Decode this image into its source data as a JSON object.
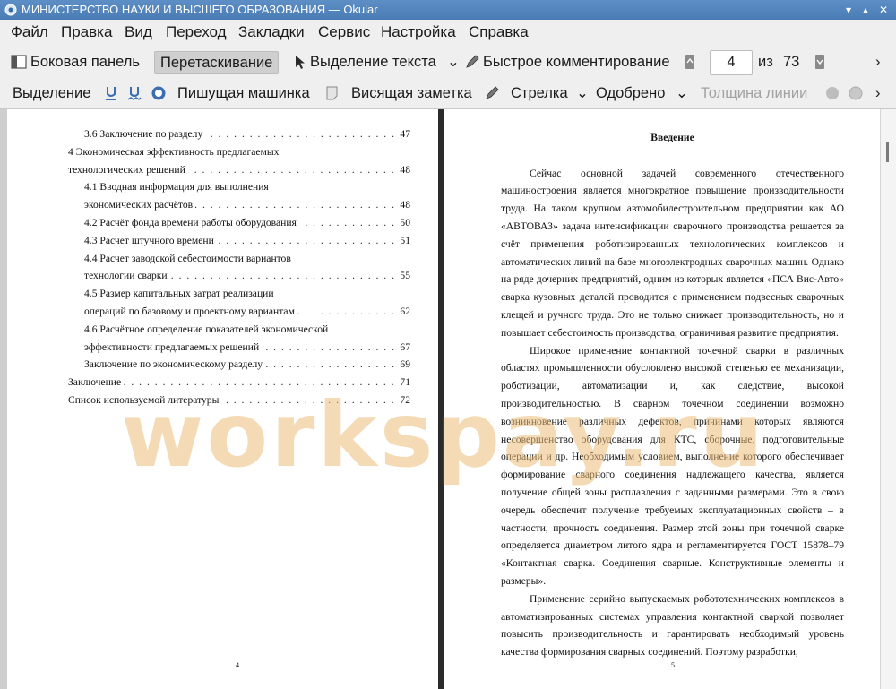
{
  "window": {
    "title": "МИНИСТЕРСТВО НАУКИ И ВЫСШЕГО ОБРАЗОВАНИЯ  — Okular"
  },
  "menu": [
    "Файл",
    "Правка",
    "Вид",
    "Переход",
    "Закладки",
    "Сервис",
    "Настройка",
    "Справка"
  ],
  "toolbar1": {
    "sidebar": "Боковая панель",
    "drag": "Перетаскивание",
    "text_select": "Выделение текста",
    "quick_comment": "Быстрое комментирование",
    "page_current": "4",
    "page_of": "из",
    "page_total": "73"
  },
  "toolbar2": {
    "selection": "Выделение",
    "typewriter": "Пишущая машинка",
    "sticky_note": "Висящая заметка",
    "arrow": "Стрелка",
    "approved": "Одобрено",
    "line_width": "Толщина линии"
  },
  "left_page": {
    "toc": [
      {
        "text": "3.6 Заключение по разделу",
        "page": "47",
        "indent": 1
      },
      {
        "text": "4 Экономическая эффективность предлагаемых",
        "page": "",
        "indent": 0
      },
      {
        "text": "технологических решений",
        "page": "48",
        "indent": 0
      },
      {
        "text": "4.1 Вводная информация для выполнения",
        "page": "",
        "indent": 1
      },
      {
        "text": "экономических расчётов",
        "page": "48",
        "indent": 1
      },
      {
        "text": "4.2 Расчёт фонда времени работы оборудования",
        "page": "50",
        "indent": 1
      },
      {
        "text": "4.3 Расчет штучного времени",
        "page": "51",
        "indent": 1
      },
      {
        "text": "4.4 Расчет заводской себестоимости вариантов",
        "page": "",
        "indent": 1
      },
      {
        "text": "технологии сварки",
        "page": "55",
        "indent": 1
      },
      {
        "text": "4.5 Размер капитальных затрат реализации",
        "page": "",
        "indent": 1
      },
      {
        "text": "операций по базовому и проектному вариантам",
        "page": "62",
        "indent": 1
      },
      {
        "text": "4.6 Расчётное определение показателей экономической",
        "page": "",
        "indent": 1
      },
      {
        "text": "эффективности предлагаемых решений",
        "page": "67",
        "indent": 1
      },
      {
        "text": "Заключение по экономическому разделу",
        "page": "69",
        "indent": 1
      },
      {
        "text": "Заключение",
        "page": "71",
        "indent": 0
      },
      {
        "text": "Список используемой литературы",
        "page": "72",
        "indent": 0
      }
    ],
    "page_number": "4"
  },
  "right_page": {
    "heading": "Введение",
    "paragraphs": [
      "Сейчас основной задачей современного отечественного машиностроения является многократное повышение производительности труда. На таком крупном автомобилестроительном предприятии как АО «АВТОВАЗ» задача интенсификации сварочного производства решается за счёт применения роботизированных технологических комплексов и автоматических линий на базе многоэлектродных сварочных машин. Однако на ряде дочерних предприятий, одним из которых является «ПСА Вис-Авто» сварка кузовных деталей проводится с применением подвесных сварочных клещей и ручного труда. Это не только снижает производительность, но и повышает себестоимость производства, ограничивая развитие предприятия.",
      "Широкое применение контактной точечной сварки в различных областях промышленности обусловлено высокой степенью ее механизации, роботизации, автоматизации и, как следствие, высокой производительностью. В сварном точечном соединении возможно возникновение различных дефектов, причинами которых являются несовершенство оборудования для КТС, сборочные, подготовительные операции и др. Необходимым условием, выполнение которого обеспечивает формирование сварного соединения надлежащего качества, является получение общей зоны расплавления с заданными размерами. Это в свою очередь обеспечит получение требуемых эксплуатационных свойств – в частности, прочность соединения. Размер этой зоны при точечной сварке определяется диаметром литого ядра и регламентируется ГОСТ 15878–79 «Контактная сварка. Соединения сварные. Конструктивные элементы и размеры».",
      "Применение серийно выпускаемых робототехнических комплексов в автоматизированных системах управления контактной сваркой позволяет повысить производительность и гарантировать необходимый уровень качества формирования сварных соединений. Поэтому разработки,"
    ],
    "page_number": "5"
  },
  "watermark": "workspay.ru"
}
